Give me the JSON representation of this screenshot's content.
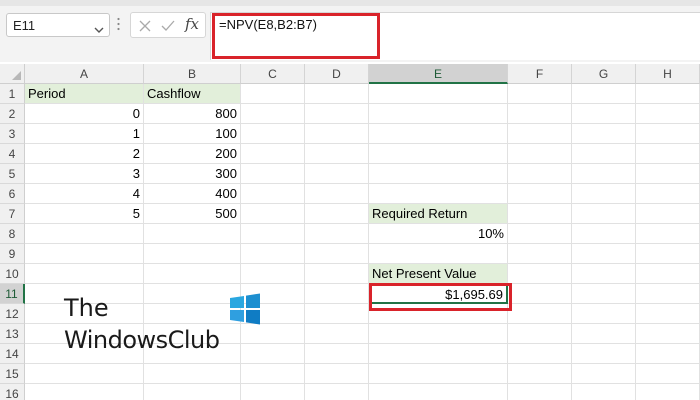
{
  "name_box": {
    "value": "E11",
    "chevron_icon": "chevron-down-icon"
  },
  "formula_bar": {
    "cancel_icon": "cancel-x-icon",
    "enter_icon": "checkmark-icon",
    "fx_label": "fx",
    "formula": "=NPV(E8,B2:B7)"
  },
  "columns": [
    "A",
    "B",
    "C",
    "D",
    "E",
    "F",
    "G",
    "H"
  ],
  "active_column": "E",
  "rows": [
    "1",
    "2",
    "3",
    "4",
    "5",
    "6",
    "7",
    "8",
    "9",
    "10",
    "11",
    "12",
    "13",
    "14",
    "15",
    "16"
  ],
  "active_row": "11",
  "sheet": {
    "a1": "Period",
    "b1": "Cashflow",
    "periods": [
      "0",
      "1",
      "2",
      "3",
      "4",
      "5"
    ],
    "cashflows": [
      "800",
      "100",
      "200",
      "300",
      "400",
      "500"
    ],
    "e7": "Required Return",
    "e8": "10%",
    "e10": "Net Present Value",
    "e11": "$1,695.69"
  },
  "watermark": {
    "line1": "The",
    "line2": "WindowsClub",
    "logo_icon": "windows-logo-icon",
    "logo_colors": [
      "#2aa7e0",
      "#1d8fd0",
      "#2f9fe0",
      "#0f7cc4"
    ]
  },
  "highlight_color": "#d9232a",
  "accent_color": "#217346"
}
